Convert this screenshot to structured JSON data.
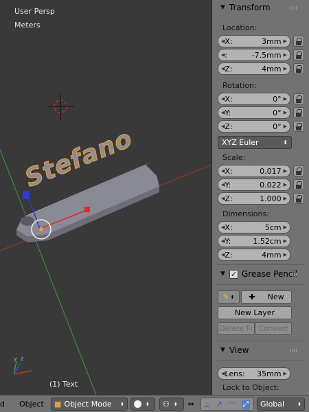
{
  "viewport": {
    "view_label": "User Persp",
    "units_label": "Meters",
    "object_label": "(1) Text",
    "text_object": "Stefano",
    "axis_y": "y",
    "axis_z": "z"
  },
  "transform": {
    "title": "Transform",
    "location_label": "Location:",
    "location": [
      {
        "axis": "X:",
        "value": "3mm"
      },
      {
        "axis": ":",
        "value": "-7.5mm"
      },
      {
        "axis": "Z:",
        "value": "4mm"
      }
    ],
    "rotation_label": "Rotation:",
    "rotation": [
      {
        "axis": "X:",
        "value": "0°"
      },
      {
        "axis": "Y:",
        "value": "0°"
      },
      {
        "axis": "Z:",
        "value": "0°"
      }
    ],
    "rotation_mode": "XYZ Euler",
    "scale_label": "Scale:",
    "scale": [
      {
        "axis": "X:",
        "value": "0.017"
      },
      {
        "axis": "Y:",
        "value": "0.022"
      },
      {
        "axis": "Z:",
        "value": "1.000"
      }
    ],
    "dimensions_label": "Dimensions:",
    "dimensions": [
      {
        "axis": "X:",
        "value": "5cm"
      },
      {
        "axis": "Y:",
        "value": "1.52cm"
      },
      {
        "axis": "Z:",
        "value": "4mm"
      }
    ]
  },
  "grease_pencil": {
    "title": "Grease Pencil",
    "new_label": "New",
    "new_layer_label": "New Layer",
    "delete_label": "Delete Fr",
    "convert_label": "Convert"
  },
  "view": {
    "title": "View",
    "lens_label": "Lens:",
    "lens_value": "35mm",
    "lock_label": "Lock to Object:"
  },
  "header": {
    "menu_add_partial": "d",
    "menu_object": "Object",
    "mode": "Object Mode",
    "orientation": "Global"
  },
  "colors": {
    "viewport_bg": "#393939",
    "panel_bg": "#727272",
    "text_outline": "#f0a030",
    "object_mesh": "#8e8e9a",
    "axis_x": "#c83232",
    "axis_y": "#32a032"
  }
}
